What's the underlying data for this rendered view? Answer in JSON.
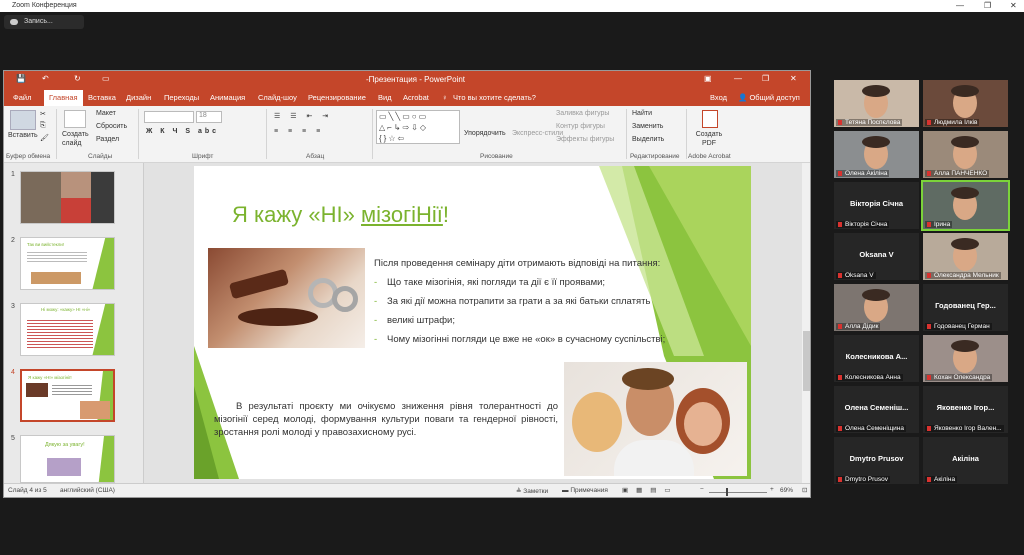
{
  "zoom": {
    "window_title": "Zoom Конференция",
    "record_label": "Запись..."
  },
  "ppt": {
    "window_title": "-Презентация - PowerPoint",
    "tabs": [
      "Файл",
      "Главная",
      "Вставка",
      "Дизайн",
      "Переходы",
      "Анимация",
      "Слайд-шоу",
      "Рецензирование",
      "Вид",
      "Acrobat"
    ],
    "tell_me": "Что вы хотите сделать?",
    "login": "Вход",
    "share": "Общий доступ",
    "ribbon": {
      "paste": "Вставить",
      "clipboard_group": "Буфер обмена",
      "new_slide": "Создать слайд",
      "layout": "Макет",
      "reset": "Сбросить",
      "section": "Раздел",
      "slides_group": "Слайды",
      "font_size": "18",
      "font_group": "Шрифт",
      "paragraph_group": "Абзац",
      "arrange": "Упорядочить",
      "quick_styles": "Экспресс-стили",
      "shape_fill": "Заливка фигуры",
      "shape_outline": "Контур фигуры",
      "shape_effects": "Эффекты фигуры",
      "drawing_group": "Рисование",
      "find": "Найти",
      "replace": "Заменить",
      "select": "Выделить",
      "editing_group": "Редактирование",
      "create_pdf": "Создать PDF",
      "acrobat_group": "Adobe Acrobat"
    },
    "thumbnails": [
      {
        "num": "1"
      },
      {
        "num": "2",
        "title": "Так ви вийстекли!"
      },
      {
        "num": "3",
        "title": "Ні можу: «кажу» НІ «ні»"
      },
      {
        "num": "4",
        "title": "Я кажу «НІ» мізогінії!"
      },
      {
        "num": "5",
        "title": "Дякую за увагу!"
      }
    ],
    "slide": {
      "title_plain": "Я кажу «НІ» ",
      "title_u": "мізогіНії",
      "title_end": "!",
      "intro": "Після проведення семінару діти отримають відповіді на питання:",
      "bullets": [
        "Що таке мізогінія, які погляди та дії є її проявами;",
        "За які дії можна потрапити за грати а за які батьки сплатять",
        "великі штрафи;",
        "Чому мізогінні погляди це вже не «ок» в сучасному суспільстві;"
      ],
      "result": "В результаті проєкту ми очікуємо зниження рівня толерантності до мізогінії серед молоді, формування культури поваги та гендерної рівності, зростання ролі молоді у правозахисному русі."
    },
    "status": {
      "slide_of": "Слайд 4 из 5",
      "language": "английский (США)",
      "notes": "Заметки",
      "comments": "Примечания",
      "zoom": "69%"
    }
  },
  "participants": [
    {
      "label": "Тетяна Поспєлова",
      "video": true,
      "bg": "#c9b9a8"
    },
    {
      "label": "Людмила Ілків",
      "video": true,
      "bg": "#6b4a3b"
    },
    {
      "label": "Олена Акіліна",
      "video": true,
      "bg": "#8b8e90"
    },
    {
      "label": "Алла ПАНЧЕНКО",
      "video": true,
      "bg": "#9b8a7a"
    },
    {
      "name": "Вікторія Січна",
      "label": "Вікторія Січна",
      "video": false
    },
    {
      "label": "Ірина",
      "video": true,
      "bg": "#5f6b63",
      "speaking": true
    },
    {
      "name": "Oksana V",
      "label": "Oksana V",
      "video": false,
      "muted": false
    },
    {
      "label": "Олександра Мельник",
      "video": true,
      "bg": "#b8aa9a"
    },
    {
      "label": "Алла Дідик",
      "video": true,
      "bg": "#7d7570"
    },
    {
      "name": "Годованец Гер...",
      "label": "Годованец Герман",
      "video": false,
      "muted": false
    },
    {
      "name": "Колесникова А...",
      "label": "Колесникова Анна",
      "video": false
    },
    {
      "label": "Кохан Олександра",
      "video": true,
      "bg": "#9c8f8a"
    },
    {
      "name": "Олена Семеніш...",
      "label": "Олена Семеніщина",
      "video": false
    },
    {
      "name": "Яковенко Ігор...",
      "label": "Яковенко Ігор Вален...",
      "video": false
    },
    {
      "name": "Dmytro Prusov",
      "label": "Dmytro Prusov",
      "video": false
    },
    {
      "name": "Акіліна",
      "label": "Акіліна",
      "video": false
    }
  ]
}
